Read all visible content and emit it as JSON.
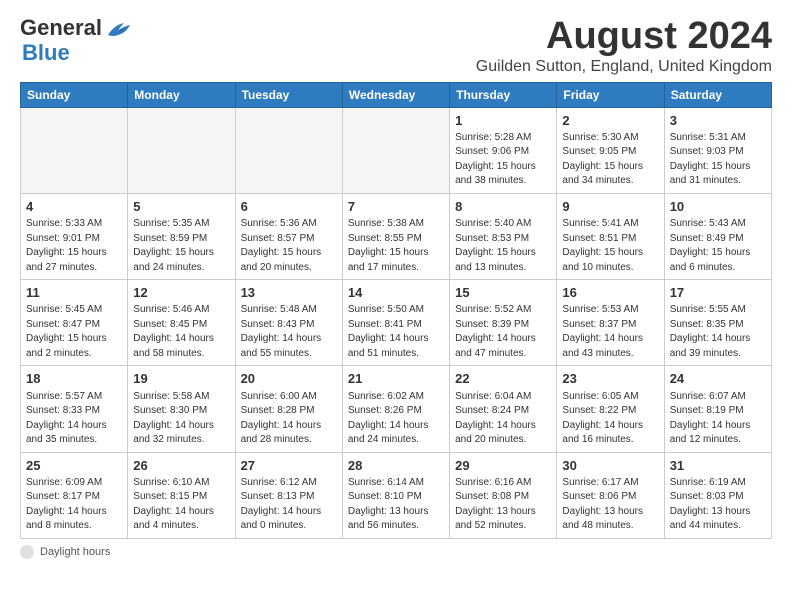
{
  "logo": {
    "general": "General",
    "blue": "Blue"
  },
  "title": {
    "month_year": "August 2024",
    "location": "Guilden Sutton, England, United Kingdom"
  },
  "weekdays": [
    "Sunday",
    "Monday",
    "Tuesday",
    "Wednesday",
    "Thursday",
    "Friday",
    "Saturday"
  ],
  "weeks": [
    [
      {
        "day": "",
        "info": "",
        "empty": true
      },
      {
        "day": "",
        "info": "",
        "empty": true
      },
      {
        "day": "",
        "info": "",
        "empty": true
      },
      {
        "day": "",
        "info": "",
        "empty": true
      },
      {
        "day": "1",
        "info": "Sunrise: 5:28 AM\nSunset: 9:06 PM\nDaylight: 15 hours\nand 38 minutes."
      },
      {
        "day": "2",
        "info": "Sunrise: 5:30 AM\nSunset: 9:05 PM\nDaylight: 15 hours\nand 34 minutes."
      },
      {
        "day": "3",
        "info": "Sunrise: 5:31 AM\nSunset: 9:03 PM\nDaylight: 15 hours\nand 31 minutes."
      }
    ],
    [
      {
        "day": "4",
        "info": "Sunrise: 5:33 AM\nSunset: 9:01 PM\nDaylight: 15 hours\nand 27 minutes."
      },
      {
        "day": "5",
        "info": "Sunrise: 5:35 AM\nSunset: 8:59 PM\nDaylight: 15 hours\nand 24 minutes."
      },
      {
        "day": "6",
        "info": "Sunrise: 5:36 AM\nSunset: 8:57 PM\nDaylight: 15 hours\nand 20 minutes."
      },
      {
        "day": "7",
        "info": "Sunrise: 5:38 AM\nSunset: 8:55 PM\nDaylight: 15 hours\nand 17 minutes."
      },
      {
        "day": "8",
        "info": "Sunrise: 5:40 AM\nSunset: 8:53 PM\nDaylight: 15 hours\nand 13 minutes."
      },
      {
        "day": "9",
        "info": "Sunrise: 5:41 AM\nSunset: 8:51 PM\nDaylight: 15 hours\nand 10 minutes."
      },
      {
        "day": "10",
        "info": "Sunrise: 5:43 AM\nSunset: 8:49 PM\nDaylight: 15 hours\nand 6 minutes."
      }
    ],
    [
      {
        "day": "11",
        "info": "Sunrise: 5:45 AM\nSunset: 8:47 PM\nDaylight: 15 hours\nand 2 minutes."
      },
      {
        "day": "12",
        "info": "Sunrise: 5:46 AM\nSunset: 8:45 PM\nDaylight: 14 hours\nand 58 minutes."
      },
      {
        "day": "13",
        "info": "Sunrise: 5:48 AM\nSunset: 8:43 PM\nDaylight: 14 hours\nand 55 minutes."
      },
      {
        "day": "14",
        "info": "Sunrise: 5:50 AM\nSunset: 8:41 PM\nDaylight: 14 hours\nand 51 minutes."
      },
      {
        "day": "15",
        "info": "Sunrise: 5:52 AM\nSunset: 8:39 PM\nDaylight: 14 hours\nand 47 minutes."
      },
      {
        "day": "16",
        "info": "Sunrise: 5:53 AM\nSunset: 8:37 PM\nDaylight: 14 hours\nand 43 minutes."
      },
      {
        "day": "17",
        "info": "Sunrise: 5:55 AM\nSunset: 8:35 PM\nDaylight: 14 hours\nand 39 minutes."
      }
    ],
    [
      {
        "day": "18",
        "info": "Sunrise: 5:57 AM\nSunset: 8:33 PM\nDaylight: 14 hours\nand 35 minutes."
      },
      {
        "day": "19",
        "info": "Sunrise: 5:58 AM\nSunset: 8:30 PM\nDaylight: 14 hours\nand 32 minutes."
      },
      {
        "day": "20",
        "info": "Sunrise: 6:00 AM\nSunset: 8:28 PM\nDaylight: 14 hours\nand 28 minutes."
      },
      {
        "day": "21",
        "info": "Sunrise: 6:02 AM\nSunset: 8:26 PM\nDaylight: 14 hours\nand 24 minutes."
      },
      {
        "day": "22",
        "info": "Sunrise: 6:04 AM\nSunset: 8:24 PM\nDaylight: 14 hours\nand 20 minutes."
      },
      {
        "day": "23",
        "info": "Sunrise: 6:05 AM\nSunset: 8:22 PM\nDaylight: 14 hours\nand 16 minutes."
      },
      {
        "day": "24",
        "info": "Sunrise: 6:07 AM\nSunset: 8:19 PM\nDaylight: 14 hours\nand 12 minutes."
      }
    ],
    [
      {
        "day": "25",
        "info": "Sunrise: 6:09 AM\nSunset: 8:17 PM\nDaylight: 14 hours\nand 8 minutes."
      },
      {
        "day": "26",
        "info": "Sunrise: 6:10 AM\nSunset: 8:15 PM\nDaylight: 14 hours\nand 4 minutes."
      },
      {
        "day": "27",
        "info": "Sunrise: 6:12 AM\nSunset: 8:13 PM\nDaylight: 14 hours\nand 0 minutes."
      },
      {
        "day": "28",
        "info": "Sunrise: 6:14 AM\nSunset: 8:10 PM\nDaylight: 13 hours\nand 56 minutes."
      },
      {
        "day": "29",
        "info": "Sunrise: 6:16 AM\nSunset: 8:08 PM\nDaylight: 13 hours\nand 52 minutes."
      },
      {
        "day": "30",
        "info": "Sunrise: 6:17 AM\nSunset: 8:06 PM\nDaylight: 13 hours\nand 48 minutes."
      },
      {
        "day": "31",
        "info": "Sunrise: 6:19 AM\nSunset: 8:03 PM\nDaylight: 13 hours\nand 44 minutes."
      }
    ]
  ],
  "footer": {
    "note": "Daylight hours"
  }
}
